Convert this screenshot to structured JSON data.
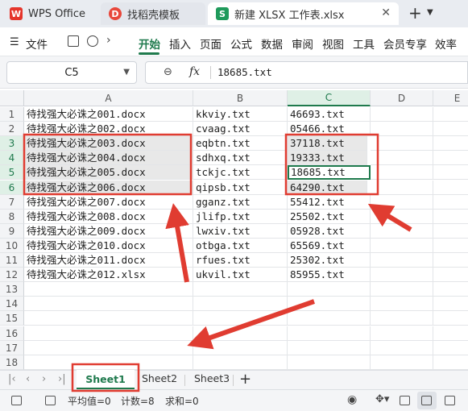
{
  "tabs": [
    {
      "label": "WPS Office",
      "icon": "wps-logo-icon"
    },
    {
      "label": "找稻壳模板",
      "icon": "docer-icon"
    },
    {
      "label": "新建 XLSX 工作表.xlsx",
      "icon": "spreadsheet-icon",
      "active": true
    }
  ],
  "menu": {
    "file": "文件",
    "items": [
      "开始",
      "插入",
      "页面",
      "公式",
      "数据",
      "审阅",
      "视图",
      "工具",
      "会员专享",
      "效率"
    ],
    "active": "开始"
  },
  "formula": {
    "cell_ref": "C5",
    "fx": "fx",
    "value": "18685.txt"
  },
  "columns": [
    "A",
    "B",
    "C",
    "D",
    "E"
  ],
  "selected_column": "C",
  "rows": [
    {
      "n": "1",
      "a": "待找强大必诛之001.docx",
      "b": "kkviy.txt",
      "c": "46693.txt"
    },
    {
      "n": "2",
      "a": "待找强大必诛之002.docx",
      "b": "cvaag.txt",
      "c": "05466.txt"
    },
    {
      "n": "3",
      "a": "待找强大必诛之003.docx",
      "b": "eqbtn.txt",
      "c": "37118.txt"
    },
    {
      "n": "4",
      "a": "待找强大必诛之004.docx",
      "b": "sdhxq.txt",
      "c": "19333.txt"
    },
    {
      "n": "5",
      "a": "待找强大必诛之005.docx",
      "b": "tckjc.txt",
      "c": "18685.txt"
    },
    {
      "n": "6",
      "a": "待找强大必诛之006.docx",
      "b": "qipsb.txt",
      "c": "64290.txt"
    },
    {
      "n": "7",
      "a": "待找强大必诛之007.docx",
      "b": "gganz.txt",
      "c": "55412.txt"
    },
    {
      "n": "8",
      "a": "待找强大必诛之008.docx",
      "b": "jlifp.txt",
      "c": "25502.txt"
    },
    {
      "n": "9",
      "a": "待找强大必诛之009.docx",
      "b": "lwxiv.txt",
      "c": "05928.txt"
    },
    {
      "n": "10",
      "a": "待找强大必诛之010.docx",
      "b": "otbga.txt",
      "c": "65569.txt"
    },
    {
      "n": "11",
      "a": "待找强大必诛之011.docx",
      "b": "rfues.txt",
      "c": "25302.txt"
    },
    {
      "n": "12",
      "a": "待找强大必诛之012.xlsx",
      "b": "ukvil.txt",
      "c": "85955.txt"
    },
    {
      "n": "13",
      "a": "",
      "b": "",
      "c": ""
    },
    {
      "n": "14",
      "a": "",
      "b": "",
      "c": ""
    },
    {
      "n": "15",
      "a": "",
      "b": "",
      "c": ""
    },
    {
      "n": "16",
      "a": "",
      "b": "",
      "c": ""
    },
    {
      "n": "17",
      "a": "",
      "b": "",
      "c": ""
    },
    {
      "n": "18",
      "a": "",
      "b": "",
      "c": ""
    }
  ],
  "selected_rows": [
    "3",
    "4",
    "5",
    "6"
  ],
  "active_cell_row": "5",
  "sheets": [
    "Sheet1",
    "Sheet2",
    "Sheet3"
  ],
  "active_sheet": "Sheet1",
  "status": {
    "average": "平均值=0",
    "count": "计数=8",
    "sum": "求和=0"
  },
  "colors": {
    "accent": "#1f7a4d",
    "annotation": "#e03c31"
  }
}
